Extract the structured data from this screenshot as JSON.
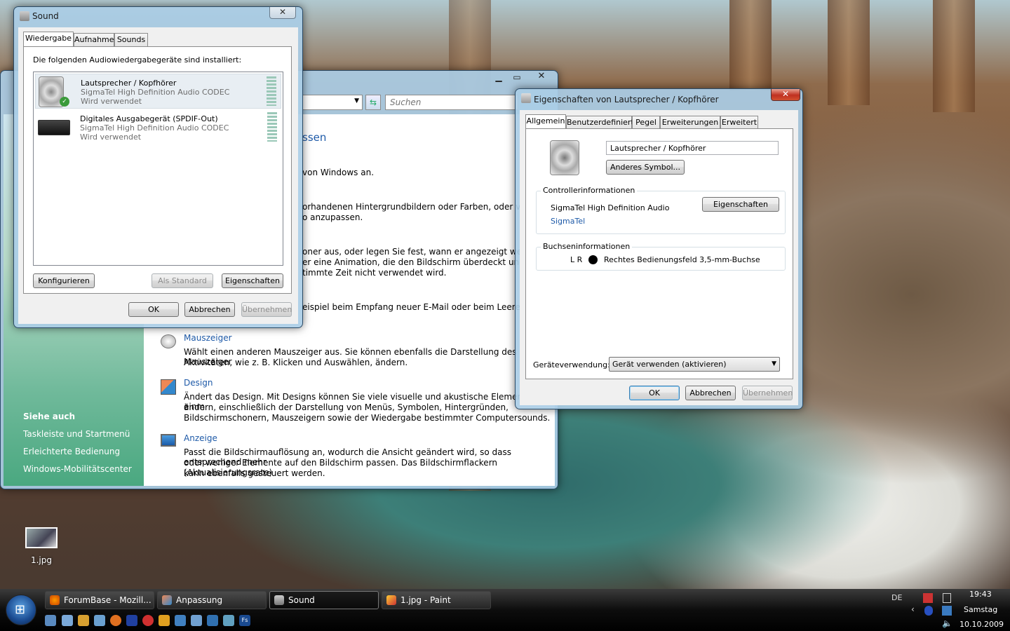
{
  "desktop": {
    "file_label": "1.jpg"
  },
  "cp": {
    "search_placeholder": "Suchen",
    "heading_fragment": "ssen",
    "lines": [
      "von Windows an.",
      "orhandenen Hintergrundbildern oder Farben, oder verwe",
      "o anzupassen.",
      "oner aus, oder legen Sie fest, wann er angezeigt werden so",
      "er eine Animation, die den Bildschirm überdeckt und ersc",
      "timmte Zeit nicht verwendet wird.",
      "eispiel beim Empfang neuer E-Mail oder beim Leeren des"
    ],
    "items": [
      {
        "title": "Mauszeiger",
        "desc": [
          "Wählt einen anderen Mauszeiger aus. Sie können ebenfalls die Darstellung des Mauszeiger",
          "Aktivitäten, wie z. B. Klicken und Auswählen, ändern."
        ]
      },
      {
        "title": "Design",
        "desc": [
          "Ändert das Design. Mit Designs können Sie viele visuelle und akustische Elemente auf einm",
          "ändern, einschließlich der Darstellung von Menüs, Symbolen, Hintergründen,",
          "Bildschirmschonern, Mauszeigern sowie der Wiedergabe bestimmter Computersounds."
        ]
      },
      {
        "title": "Anzeige",
        "desc": [
          "Passt die Bildschirmauflösung an, wodurch die Ansicht geändert wird, so dass entsprechend mehr",
          "oder weniger Elemente auf den Bildschirm passen. Das Bildschirmflackern (Aktualisierungsrate)",
          "kann ebenfalls gesteuert werden."
        ]
      }
    ],
    "see_also": "Siehe auch",
    "see_links": [
      "Taskleiste und Startmenü",
      "Erleichterte Bedienung",
      "Windows-Mobilitätscenter"
    ]
  },
  "sound": {
    "title": "Sound",
    "tabs": [
      "Wiedergabe",
      "Aufnahme",
      "Sounds"
    ],
    "intro": "Die folgenden Audiowiedergabegeräte sind installiert:",
    "devices": [
      {
        "name": "Lautsprecher / Kopfhörer",
        "driver": "SigmaTel High Definition Audio CODEC",
        "status": "Wird verwendet"
      },
      {
        "name": "Digitales Ausgabegerät (SPDIF-Out)",
        "driver": "SigmaTel High Definition Audio CODEC",
        "status": "Wird verwendet"
      }
    ],
    "configure": "Konfigurieren",
    "set_default": "Als Standard",
    "properties": "Eigenschaften",
    "ok": "OK",
    "cancel": "Abbrechen",
    "apply": "Übernehmen"
  },
  "props": {
    "title": "Eigenschaften von Lautsprecher / Kopfhörer",
    "tabs": [
      "Allgemein",
      "Benutzerdefiniert",
      "Pegel",
      "Erweiterungen",
      "Erweitert"
    ],
    "name_value": "Lautsprecher / Kopfhörer",
    "change_icon": "Anderes Symbol...",
    "controller_label": "Controllerinformationen",
    "controller_name": "SigmaTel High Definition Audio",
    "controller_link": "SigmaTel",
    "controller_props": "Eigenschaften",
    "jack_label": "Buchseninformationen",
    "jack_lr": "L R",
    "jack_desc": "Rechtes Bedienungsfeld 3,5-mm-Buchse",
    "usage_label": "Geräteverwendung:",
    "usage_value": "Gerät verwenden (aktivieren)",
    "ok": "OK",
    "cancel": "Abbrechen",
    "apply": "Übernehmen"
  },
  "taskbar": {
    "buttons": [
      "ForumBase - Mozill...",
      "Anpassung",
      "Sound",
      "1.jpg - Paint"
    ],
    "lang": "DE",
    "time": "19:43",
    "day": "Samstag",
    "date": "10.10.2009"
  }
}
